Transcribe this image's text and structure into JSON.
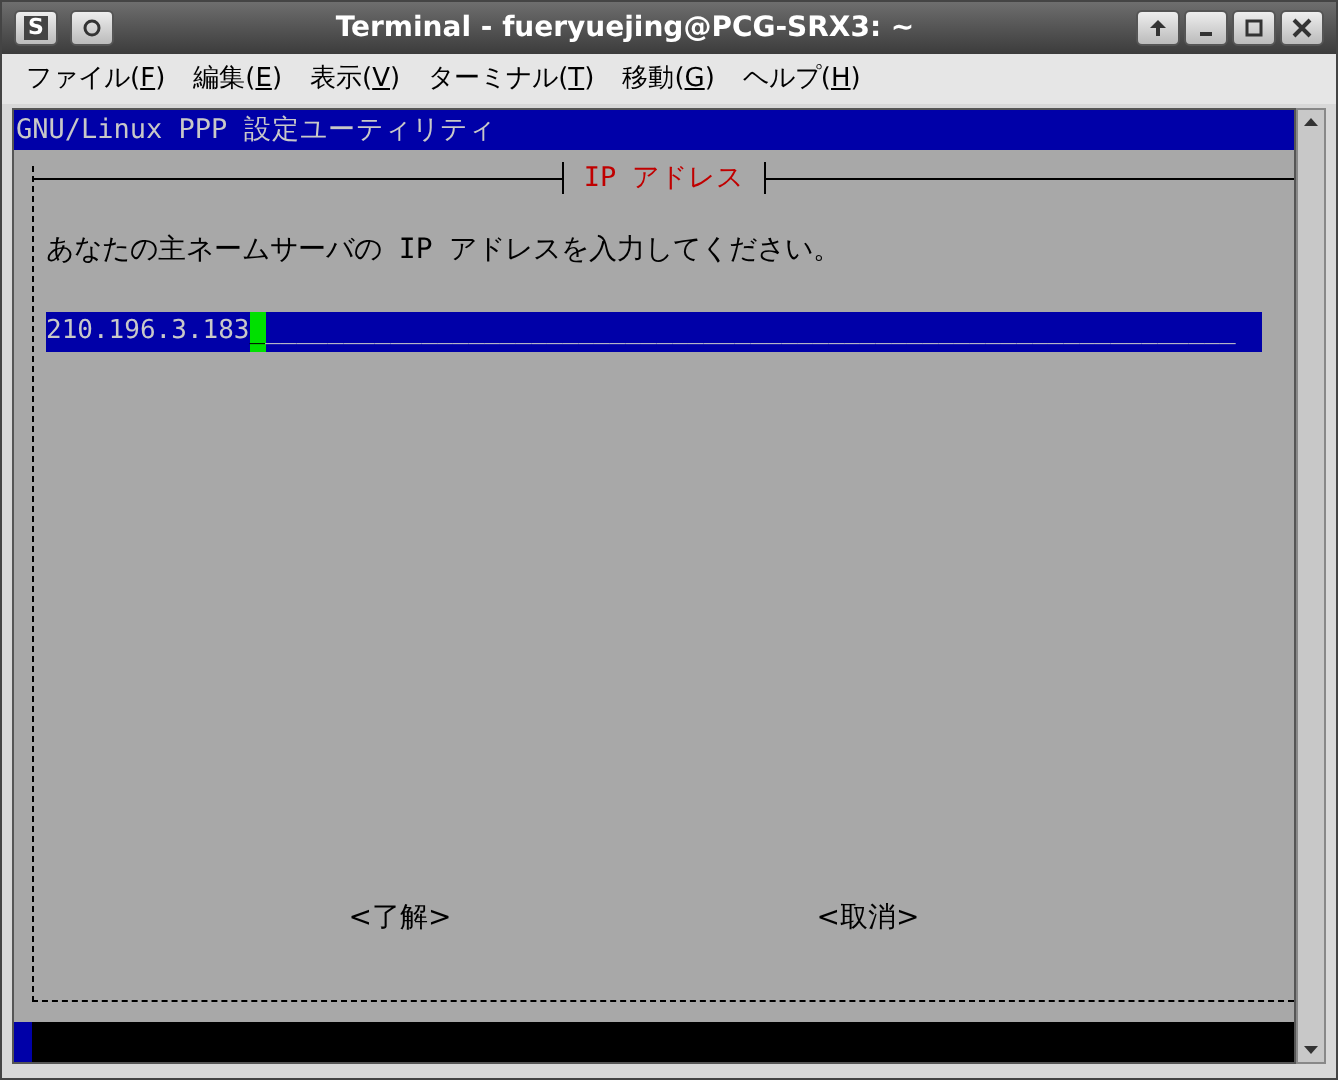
{
  "window": {
    "title": "Terminal - fueryuejing@PCG-SRX3: ~",
    "menu_glyph": "S"
  },
  "menu": [
    "ファイル(F)",
    "編集(E)",
    "表示(V)",
    "ターミナル(T)",
    "移動(G)",
    "ヘルプ(H)"
  ],
  "terminal": {
    "header": "GNU/Linux PPP 設定ユーティリティ",
    "dialog": {
      "title": "IP アドレス",
      "prompt": "あなたの主ネームサーバの IP アドレスを入力してください。",
      "field": {
        "value": "210.196.3.183",
        "cursor": "_",
        "fill": "______________________________________________________________"
      },
      "buttons": [
        "<了解>",
        "<取消>"
      ]
    }
  }
}
